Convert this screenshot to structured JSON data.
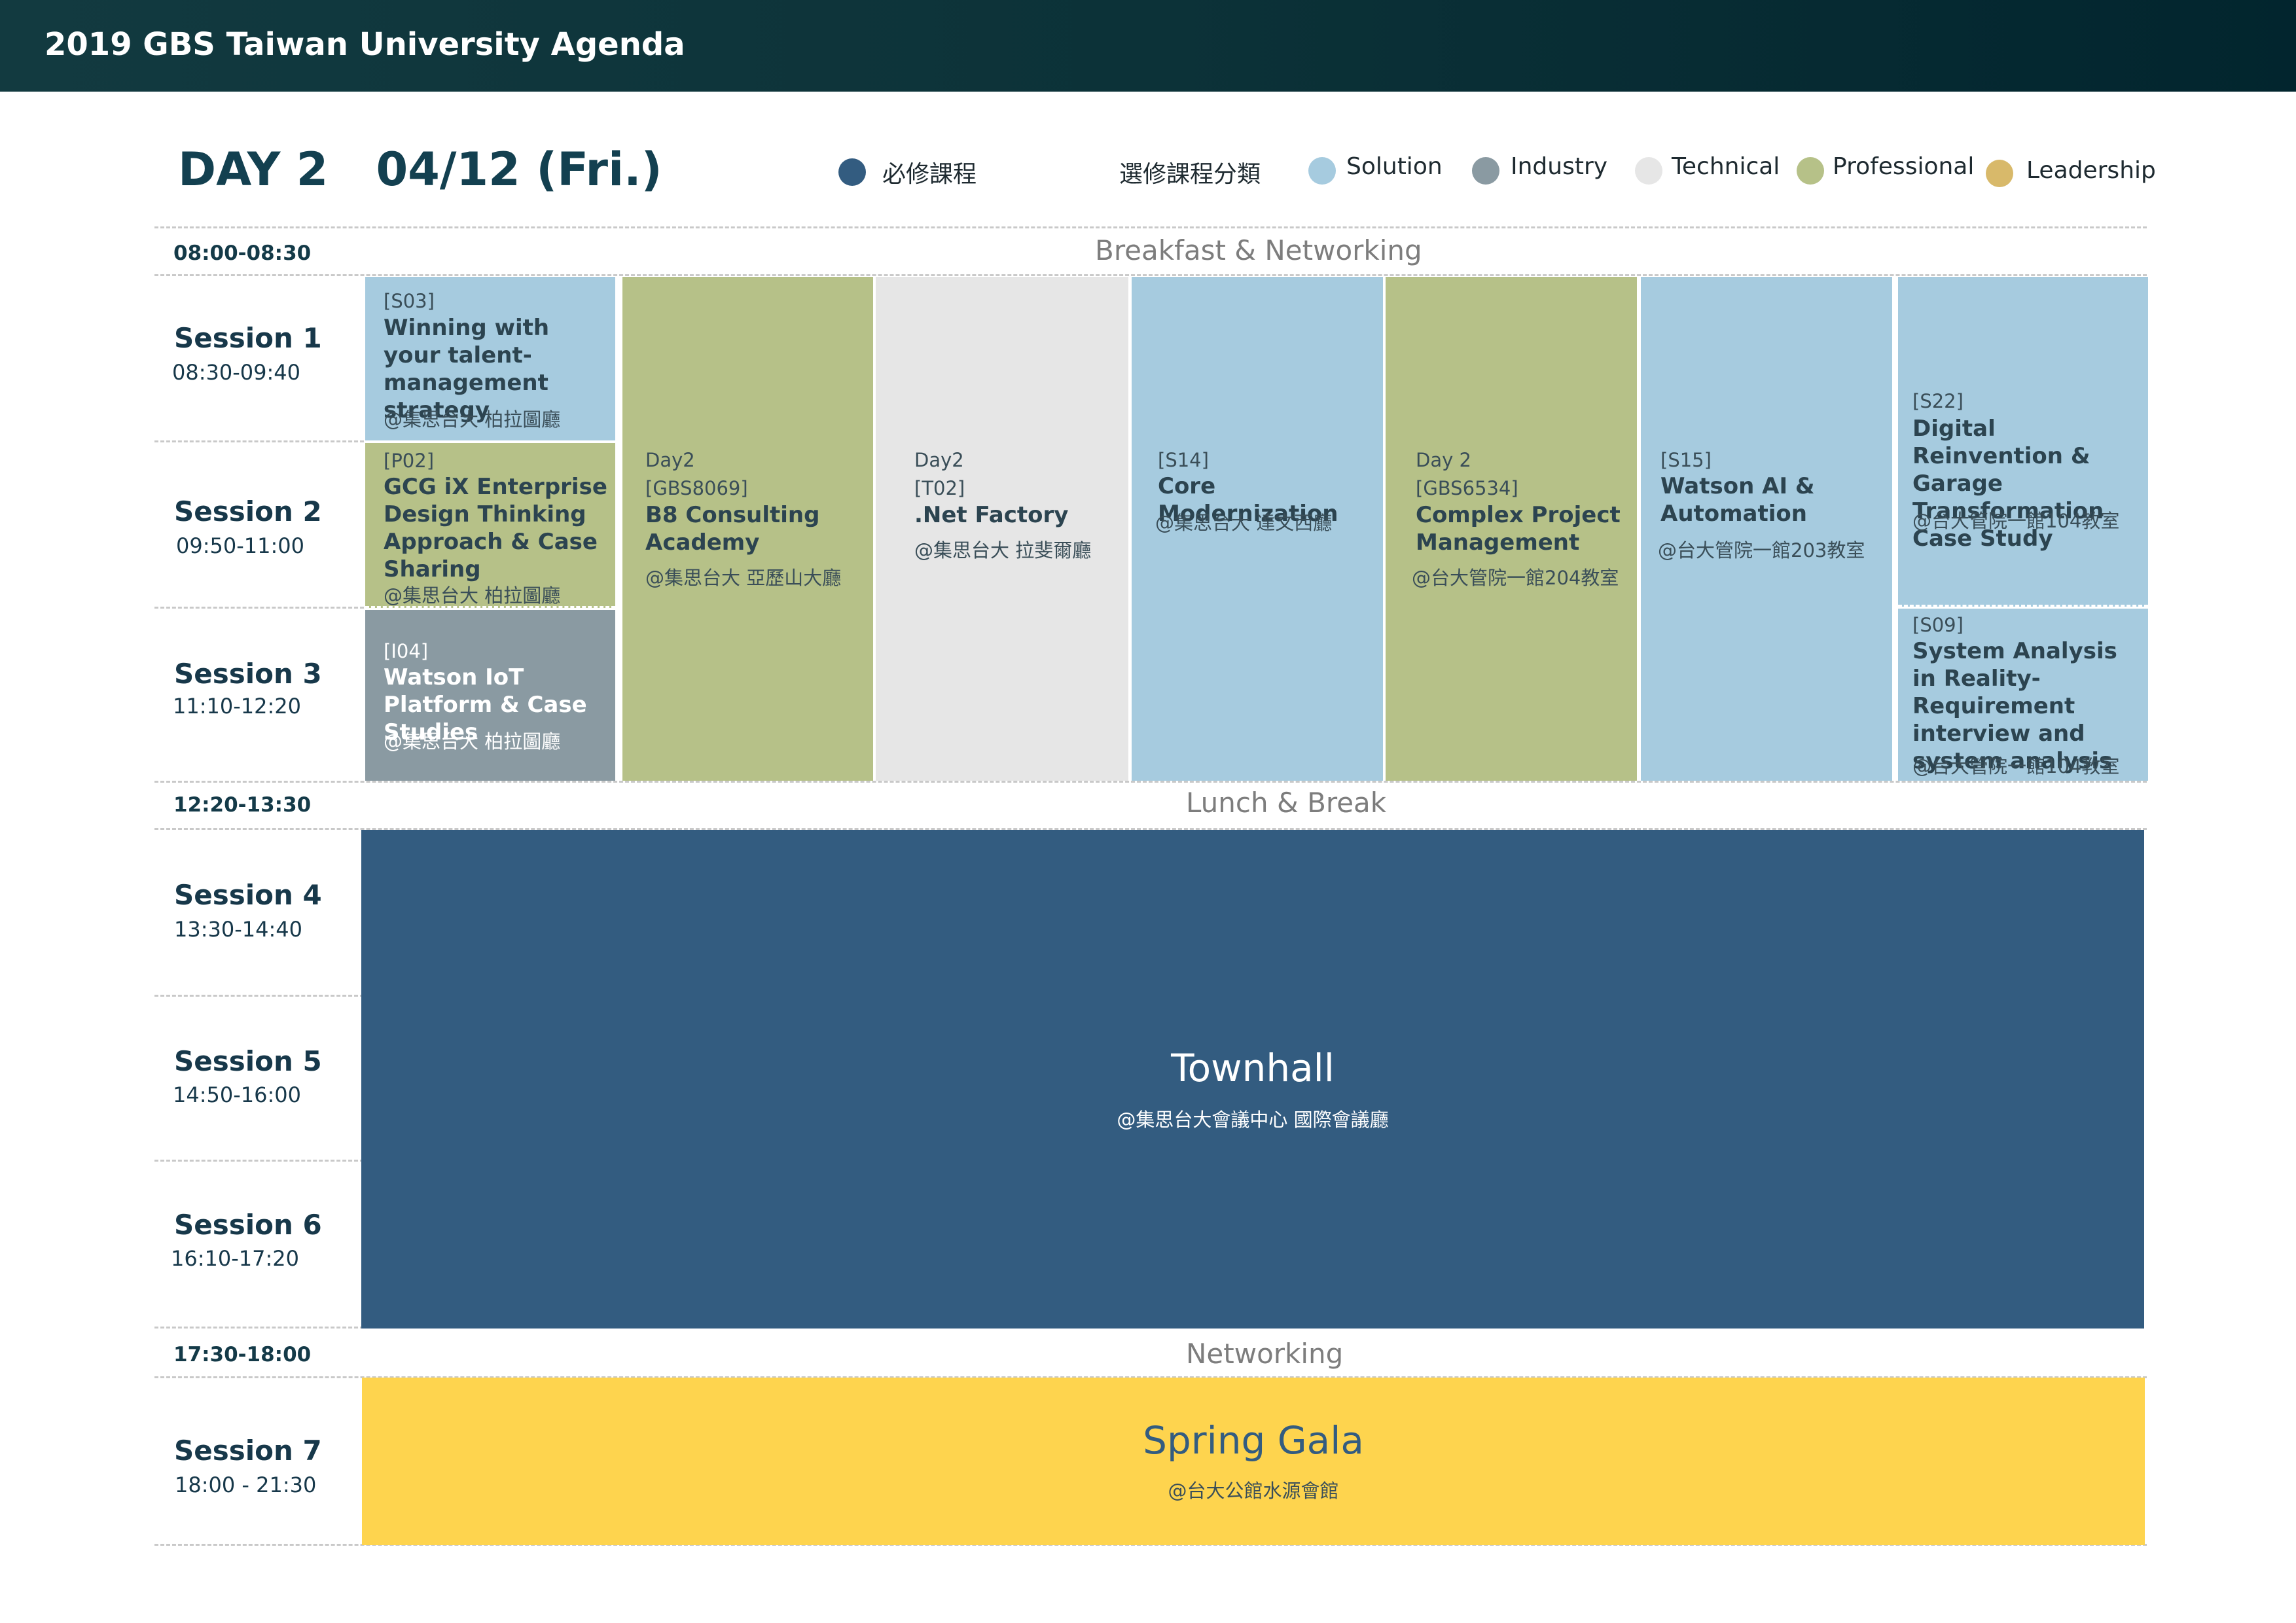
{
  "header": {
    "title": "2019 GBS Taiwan University Agenda"
  },
  "day_title": "DAY 2   04/12 (Fri.)",
  "legend": {
    "required_label": "必修課程",
    "required_color": "#335c80",
    "elective_heading": "選修課程分類",
    "categories": [
      {
        "label": "Solution",
        "color": "#a6cbdf"
      },
      {
        "label": "Industry",
        "color": "#8a9aa2"
      },
      {
        "label": "Technical",
        "color": "#e6e6e6"
      },
      {
        "label": "Professional",
        "color": "#b6c188"
      },
      {
        "label": "Leadership",
        "color": "#d8b96a"
      }
    ]
  },
  "breaks": [
    {
      "time": "08:00-08:30",
      "label": "Breakfast & Networking"
    },
    {
      "time": "12:20-13:30",
      "label": "Lunch & Break"
    },
    {
      "time": "17:30-18:00",
      "label": "Networking"
    }
  ],
  "sessions": [
    {
      "name": "Session 1",
      "time": "08:30-09:40"
    },
    {
      "name": "Session 2",
      "time": "09:50-11:00"
    },
    {
      "name": "Session 3",
      "time": "11:10-12:20"
    },
    {
      "name": "Session 4",
      "time": "13:30-14:40"
    },
    {
      "name": "Session 5",
      "time": "14:50-16:00"
    },
    {
      "name": "Session 6",
      "time": "16:10-17:20"
    },
    {
      "name": "Session 7",
      "time": "18:00 - 21:30"
    }
  ],
  "courses": [
    {
      "code": "[S03]",
      "title": "Winning with your talent-management strategy",
      "venue": "@集思台大 柏拉圖廳",
      "category": "Solution"
    },
    {
      "code": "[P02]",
      "title": "GCG iX Enterprise Design Thinking Approach & Case Sharing",
      "venue": "@集思台大 柏拉圖廳",
      "category": "Professional"
    },
    {
      "code": "[I04]",
      "title": "Watson IoT Platform & Case Studies",
      "venue": "@集思台大 柏拉圖廳",
      "category": "Industry"
    },
    {
      "day": "Day2",
      "code": "[GBS8069]",
      "title": "B8 Consulting Academy",
      "venue": "@集思台大 亞歷山大廳",
      "category": "Professional"
    },
    {
      "day": "Day2",
      "code": "[T02]",
      "title": ".Net Factory",
      "venue": "@集思台大 拉斐爾廳",
      "category": "Technical"
    },
    {
      "code": "[S14]",
      "title": "Core Modernization",
      "venue": "@集思台大 達文西廳",
      "category": "Solution"
    },
    {
      "day": "Day 2",
      "code": "[GBS6534]",
      "title": "Complex Project Management",
      "venue": "@台大管院一館204教室",
      "category": "Professional"
    },
    {
      "code": "[S15]",
      "title": "Watson AI & Automation",
      "venue": "@台大管院一館203教室",
      "category": "Solution"
    },
    {
      "code": "[S22]",
      "title": "Digital Reinvention & Garage Transformation Case Study",
      "venue": "@台大管院一館104教室",
      "category": "Solution"
    },
    {
      "code": "[S09]",
      "title": "System Analysis in Reality-Requirement interview and system analysis",
      "venue": "@台大管院一館104教室",
      "category": "Solution"
    }
  ],
  "townhall": {
    "title": "Townhall",
    "venue": "@集思台大會議中心 國際會議廳"
  },
  "gala": {
    "title": "Spring Gala",
    "venue": "@台大公館水源會館"
  }
}
